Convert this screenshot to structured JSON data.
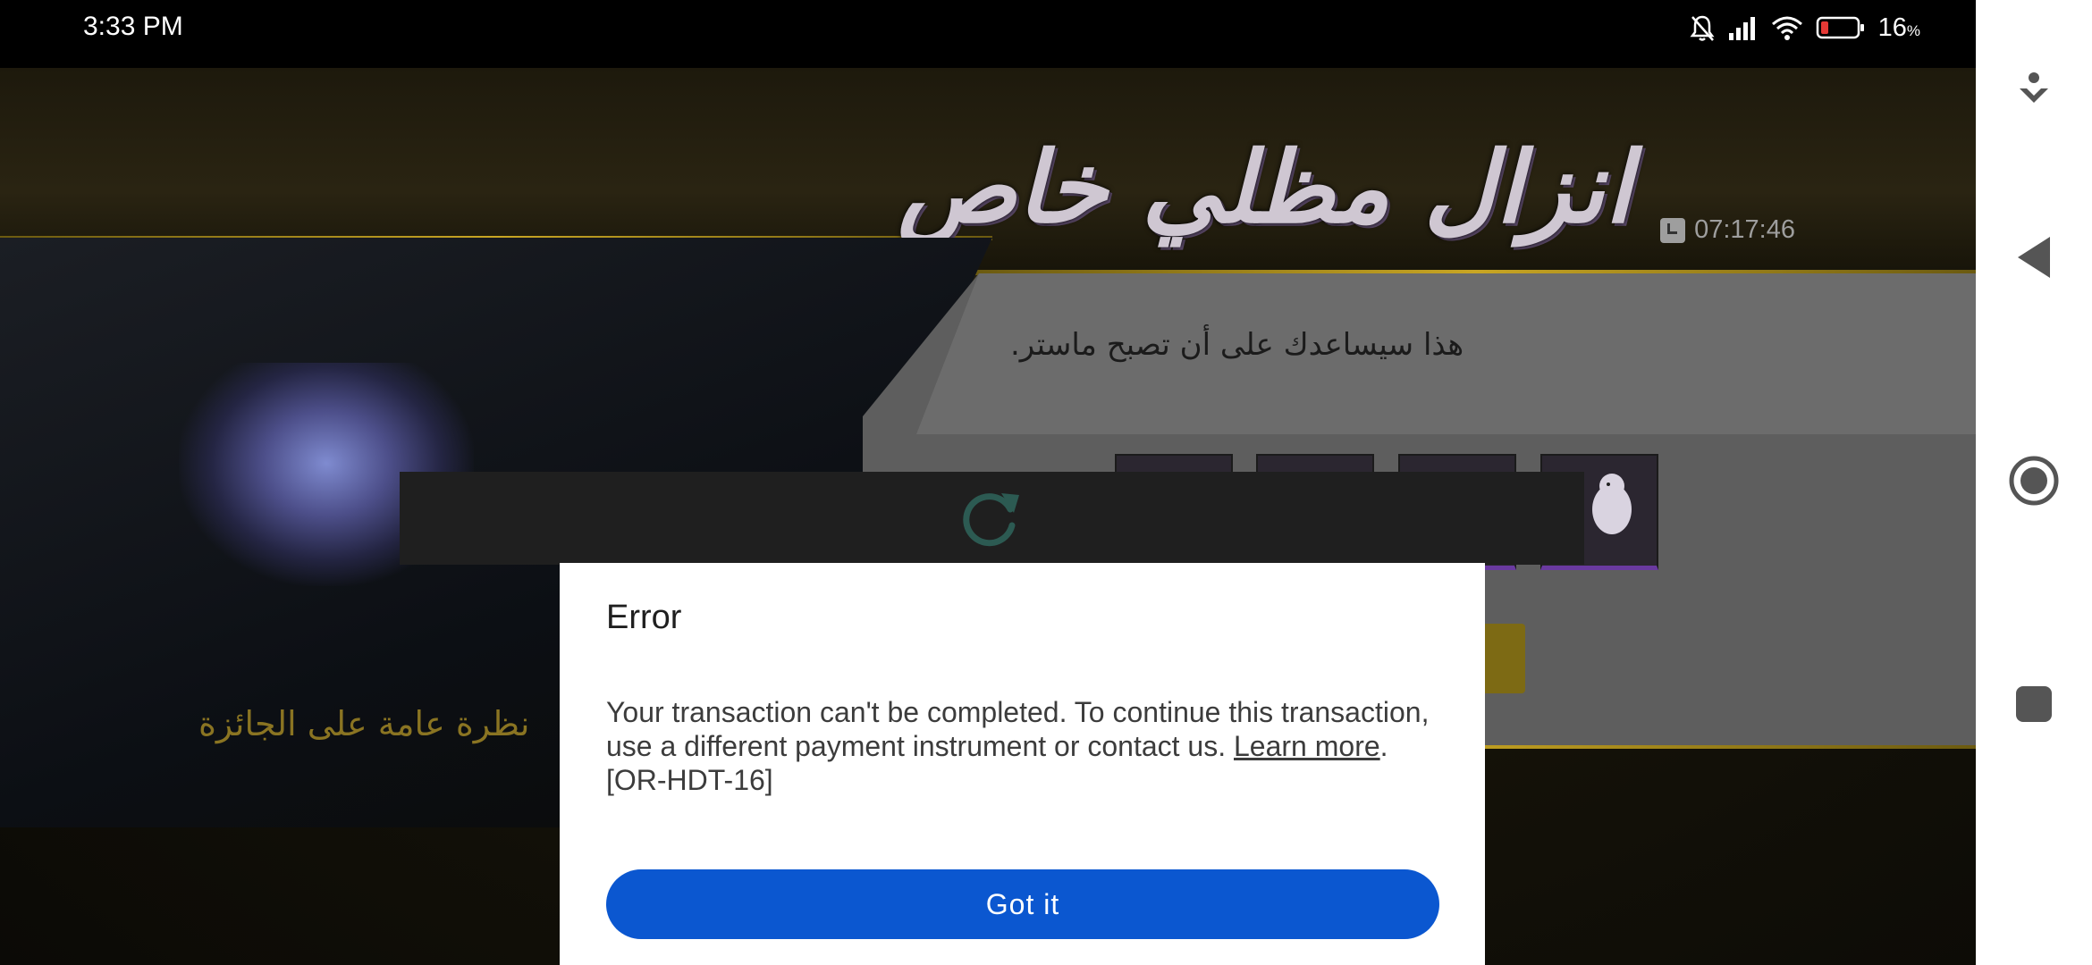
{
  "status_bar": {
    "time": "3:33 PM",
    "battery_percent": "16",
    "battery_unit": "%",
    "icons": [
      "mute-icon",
      "signal-icon",
      "wifi-icon",
      "battery-icon"
    ]
  },
  "game": {
    "title": "انزال مظلي خاص",
    "timer": "07:17:46",
    "subtitle": "هذا سيساعدك على أن تصبح ماستر.",
    "reward_overview": "نظرة عامة على الجائزة"
  },
  "dialog": {
    "title": "Error",
    "message_before_link": "Your transaction can't be completed. To continue this transaction, use a different payment instrument or contact us. ",
    "link_label": "Learn more",
    "message_after_link": ".",
    "error_code": "[OR-HDT-16]",
    "button_label": "Got it"
  },
  "colors": {
    "button": "#0b57d0",
    "dialog_bg": "#ffffff",
    "overlay": "#000000"
  },
  "nav_bar": {
    "buttons": [
      "download-icon",
      "back-icon",
      "home-icon",
      "recents-icon"
    ]
  }
}
